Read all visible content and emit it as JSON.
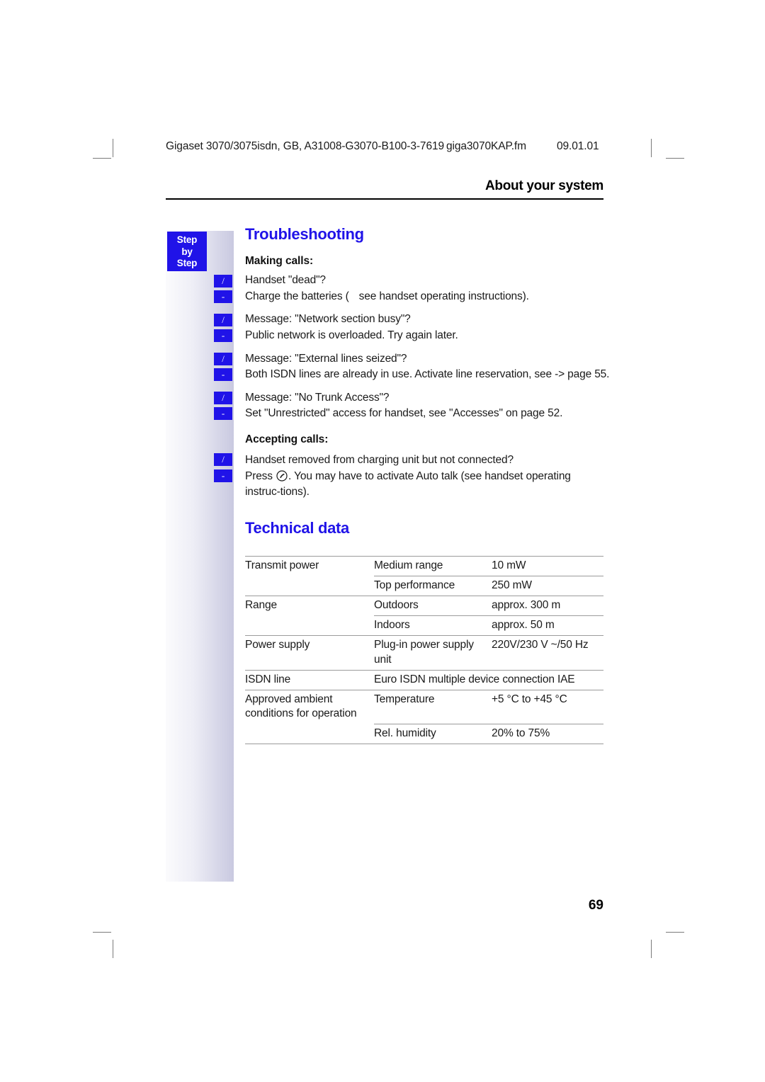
{
  "page": {
    "folio": "69",
    "running_head": "About your system",
    "header_line": "Gigaset 3070/3075isdn, GB, A31008-G3070-B100-3-7619",
    "header_fileref": "giga3070KAP.fm",
    "header_date": "09.01.01",
    "accent_color": "#2013e8",
    "rail_label_line1": "Step",
    "rail_label_line2": "by",
    "rail_label_line3": "Step"
  },
  "troubleshooting": {
    "title": "Troubleshooting",
    "groups": [
      {
        "subhead": "Making calls:",
        "items": [
          {
            "marker_q": "/",
            "marker_a": "-",
            "question": "Handset \"dead\"?",
            "answer_pre": "Charge the batteries (",
            "answer_post": "see handset operating instructions)."
          },
          {
            "marker_q": "/",
            "marker_a": "-",
            "question": "Message: \"Network section busy\"?",
            "answer": "Public network is overloaded. Try again later."
          },
          {
            "marker_q": "/",
            "marker_a": "-",
            "question": "Message: \"External lines seized\"?",
            "answer": "Both ISDN lines are already in use. Activate line reservation, see -> page 55."
          },
          {
            "marker_q": "/",
            "marker_a": "-",
            "question": "Message: \"No Trunk Access\"?",
            "answer": "Set \"Unrestricted\" access for handset, see \"Accesses\" on page 52."
          }
        ]
      },
      {
        "subhead": "Accepting calls:",
        "items": [
          {
            "marker_q": "/",
            "marker_a": "-",
            "question": "Handset removed from charging unit but not connected?",
            "answer_pre": "Press",
            "answer_post": ". You may have to activate Auto talk (see handset operating instruc-tions)."
          }
        ]
      }
    ]
  },
  "technical_data": {
    "title": "Technical data",
    "rows": [
      {
        "c1": "Transmit power",
        "c2": "Medium range",
        "c3": "10 mW"
      },
      {
        "c1": "",
        "c2": "Top performance",
        "c3": "250 mW"
      },
      {
        "c1": "Range",
        "c2": "Outdoors",
        "c3": "approx. 300 m"
      },
      {
        "c1": "",
        "c2": "Indoors",
        "c3": "approx. 50 m"
      },
      {
        "c1": "Power supply",
        "c2": "Plug-in power supply unit",
        "c3": "220V/230 V ~/50 Hz"
      },
      {
        "c1": "ISDN line",
        "c2": "Euro ISDN multiple device connection IAE",
        "c3": ""
      },
      {
        "c1": "Approved ambient conditions for operation",
        "c2": "Temperature",
        "c3": "+5 °C to +45 °C"
      },
      {
        "c1": "",
        "c2": "Rel. humidity",
        "c3": "20% to 75%"
      }
    ]
  }
}
